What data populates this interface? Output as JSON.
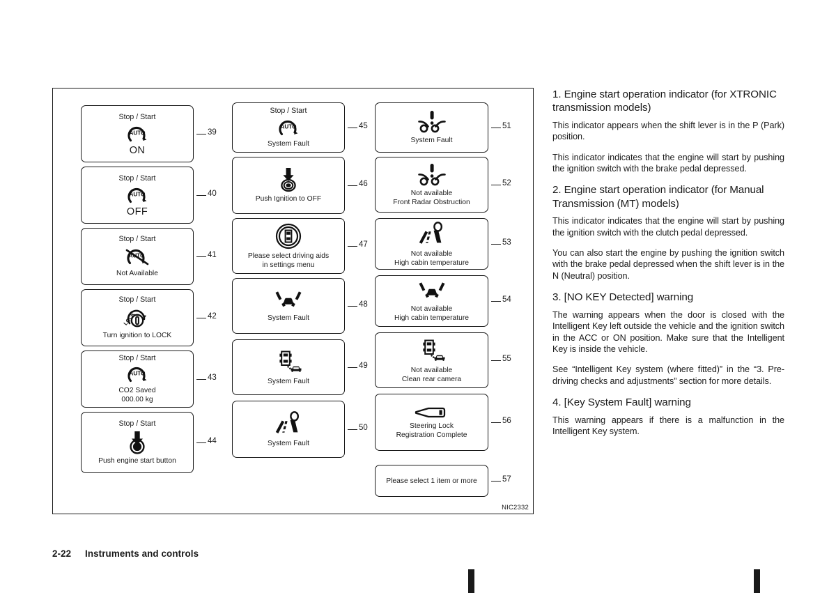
{
  "figure": {
    "code": "NIC2332",
    "columns": [
      {
        "id": "col-a",
        "items": [
          {
            "num": "39",
            "header": "Stop / Start",
            "icon": "auto-stop-start-icon",
            "caption": "ON",
            "caption_style": "big"
          },
          {
            "num": "40",
            "header": "Stop / Start",
            "icon": "auto-stop-start-icon",
            "caption": "OFF",
            "caption_style": "big"
          },
          {
            "num": "41",
            "header": "Stop / Start",
            "icon": "auto-stop-start-disabled-icon",
            "caption": "Not Available",
            "caption_style": "normal"
          },
          {
            "num": "42",
            "header": "Stop / Start",
            "icon": "ignition-lock-icon",
            "caption": "Turn ignition to LOCK",
            "caption_style": "normal"
          },
          {
            "num": "43",
            "header": "Stop / Start",
            "icon": "auto-stop-start-icon",
            "caption": "CO2 Saved\n000.00 kg",
            "caption_style": "normal"
          },
          {
            "num": "44",
            "header": "Stop / Start",
            "icon": "push-start-button-icon",
            "caption": "Push engine start button",
            "caption_style": "normal"
          }
        ]
      },
      {
        "id": "col-b",
        "items": [
          {
            "num": "45",
            "header": "Stop / Start",
            "icon": "auto-stop-start-icon",
            "caption": "System Fault",
            "caption_style": "normal"
          },
          {
            "num": "46",
            "header": "",
            "icon": "push-ignition-off-icon",
            "caption": "Push Ignition to OFF",
            "caption_style": "normal"
          },
          {
            "num": "47",
            "header": "",
            "icon": "driving-aids-icon",
            "caption": "Please select driving aids\nin settings menu",
            "caption_style": "normal"
          },
          {
            "num": "48",
            "header": "",
            "icon": "lane-departure-icon",
            "caption": "System Fault",
            "caption_style": "normal"
          },
          {
            "num": "49",
            "header": "",
            "icon": "rear-cross-traffic-icon",
            "caption": "System Fault",
            "caption_style": "normal"
          },
          {
            "num": "50",
            "header": "",
            "icon": "pedestrian-road-icon",
            "caption": "System Fault",
            "caption_style": "normal"
          }
        ]
      },
      {
        "id": "col-c",
        "items": [
          {
            "num": "51",
            "header": "",
            "icon": "front-radar-icon",
            "caption": "System Fault",
            "caption_style": "normal"
          },
          {
            "num": "52",
            "header": "",
            "icon": "front-radar-icon",
            "caption": "Not available\nFront Radar Obstruction",
            "caption_style": "normal"
          },
          {
            "num": "53",
            "header": "",
            "icon": "pedestrian-road-icon",
            "caption": "Not available\nHigh cabin temperature",
            "caption_style": "normal"
          },
          {
            "num": "54",
            "header": "",
            "icon": "lane-departure-icon",
            "caption": "Not available\nHigh cabin temperature",
            "caption_style": "normal"
          },
          {
            "num": "55",
            "header": "",
            "icon": "rear-cross-traffic-icon",
            "caption": "Not available\nClean rear camera",
            "caption_style": "normal"
          },
          {
            "num": "56",
            "header": "",
            "icon": "key-icon",
            "caption": "Steering Lock\nRegistration Complete",
            "caption_style": "normal"
          },
          {
            "num": "57",
            "header": "",
            "icon": "none",
            "caption": "Please select 1 item or more",
            "caption_style": "normal"
          }
        ]
      }
    ]
  },
  "body": {
    "heading1": "1. Engine start operation indicator (for XTRONIC transmission models)",
    "para1": "This indicator appears when the shift lever is in the P (Park) position.",
    "para2": "This indicator indicates that the engine will start by pushing the ignition switch with the brake pedal depressed.",
    "heading2": "2. Engine start operation indicator (for Manual Transmission (MT) models)",
    "para3": "This indicator indicates that the engine will start by pushing the ignition switch with the clutch pedal depressed.",
    "para4": "You can also start the engine by pushing the ignition switch with the brake pedal depressed when the shift lever is in the N (Neutral) position.",
    "heading3": "3. [NO KEY Detected] warning",
    "para5": "The warning appears when the door is closed with the Intelligent Key left outside the vehicle and the ignition switch in the ACC or ON position. Make sure that the Intelligent Key is inside the vehicle.",
    "para6": "See “Intelligent Key system (where fitted)” in the “3. Pre-driving checks and adjustments” section for more details.",
    "heading4": "4. [Key System Fault] warning",
    "para7": "This warning appears if there is a malfunction in the Intelligent Key system."
  },
  "footer": {
    "page_number": "2-22",
    "section_title": "Instruments and controls"
  }
}
